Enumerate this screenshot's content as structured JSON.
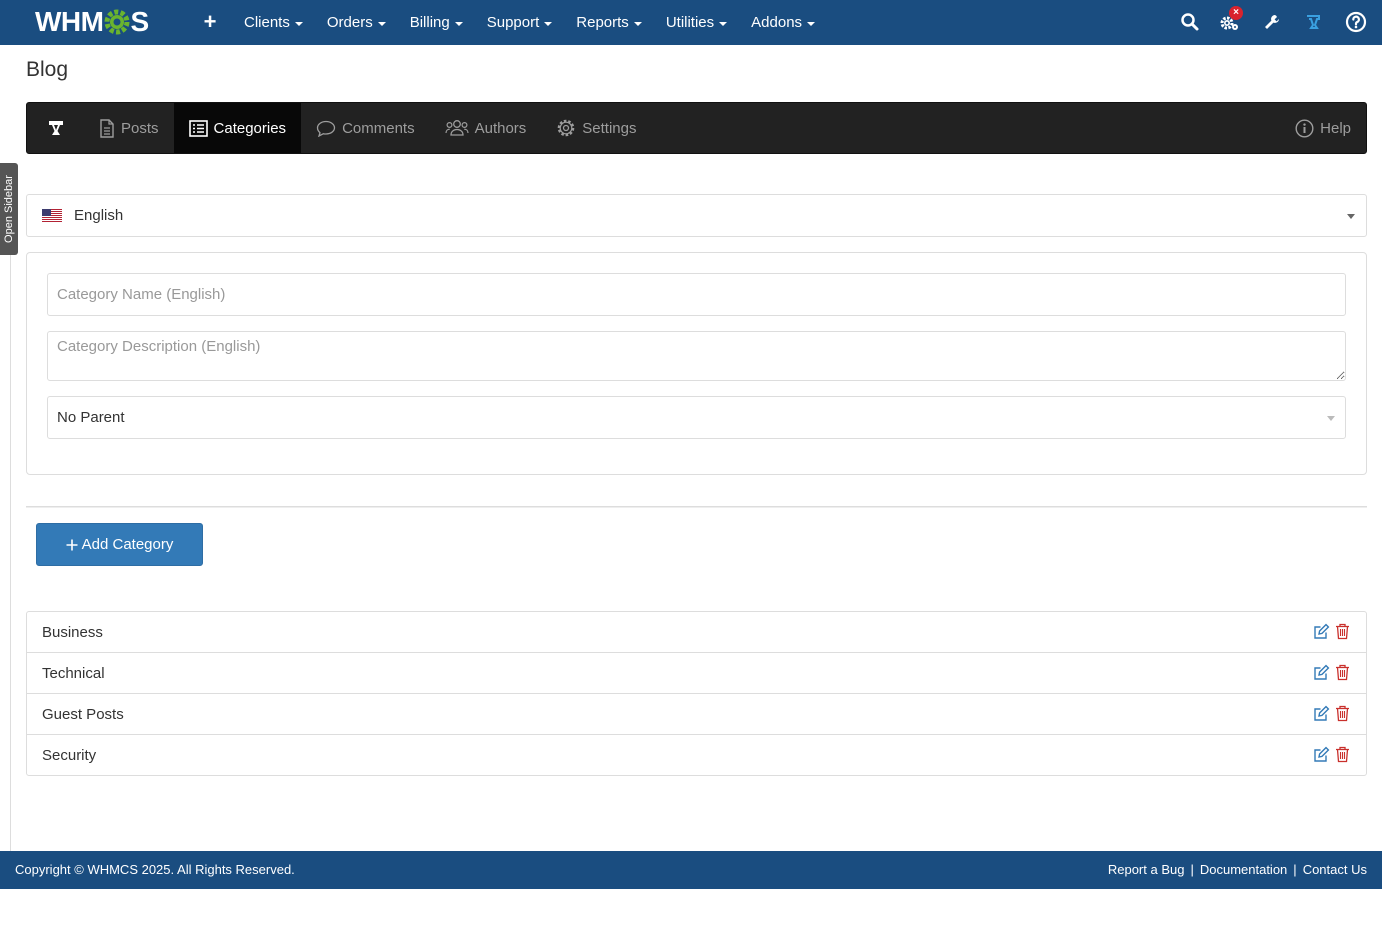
{
  "app": {
    "logo_text_left": "WHM",
    "logo_text_right": "S"
  },
  "topnav": {
    "menu": [
      {
        "label": "Clients"
      },
      {
        "label": "Orders"
      },
      {
        "label": "Billing"
      },
      {
        "label": "Support"
      },
      {
        "label": "Reports"
      },
      {
        "label": "Utilities"
      },
      {
        "label": "Addons"
      }
    ],
    "icons": [
      "plus-icon",
      "search-icon",
      "automation-gears-icon",
      "wrench-icon",
      "blog-module-icon",
      "help-circle-icon"
    ],
    "badge": "×"
  },
  "sidebar": {
    "toggle_label": "Open Sidebar"
  },
  "page": {
    "title": "Blog"
  },
  "blognav": {
    "tabs": [
      {
        "label": "Posts",
        "icon": "document-icon"
      },
      {
        "label": "Categories",
        "icon": "list-icon",
        "active": true
      },
      {
        "label": "Comments",
        "icon": "comment-icon"
      },
      {
        "label": "Authors",
        "icon": "users-icon"
      },
      {
        "label": "Settings",
        "icon": "gear-icon"
      }
    ],
    "help_label": "Help"
  },
  "language_select": {
    "value": "English",
    "flag": "us-flag-icon"
  },
  "form": {
    "name_placeholder": "Category Name (English)",
    "description_placeholder": "Category Description (English)",
    "parent_value": "No Parent"
  },
  "add_button": {
    "label": "Add Category"
  },
  "categories": [
    {
      "name": "Business"
    },
    {
      "name": "Technical"
    },
    {
      "name": "Guest Posts"
    },
    {
      "name": "Security"
    }
  ],
  "footer": {
    "copyright": "Copyright © WHMCS 2025. All Rights Reserved.",
    "links": [
      "Report a Bug",
      "Documentation",
      "Contact Us"
    ],
    "separator": "|"
  },
  "colors": {
    "nav_bg": "#1a4d80",
    "blognav_bg": "#222222",
    "primary_button": "#337ab7",
    "edit_icon": "#337ab7",
    "delete_icon": "#c9302c",
    "logo_gear": "#6ab42e"
  }
}
